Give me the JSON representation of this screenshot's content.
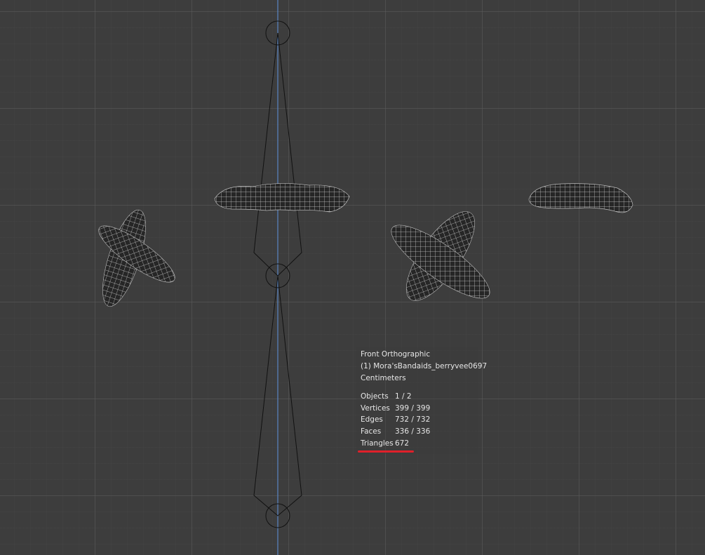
{
  "viewport": {
    "view_name": "Front Orthographic",
    "active_object": "(1) Mora'sBandaids_berryvee0697",
    "units": "Centimeters"
  },
  "stats": [
    {
      "label": "Objects",
      "value": "1 / 2"
    },
    {
      "label": "Vertices",
      "value": "399 / 399"
    },
    {
      "label": "Edges",
      "value": "732 / 732"
    },
    {
      "label": "Faces",
      "value": "336 / 336"
    },
    {
      "label": "Triangles",
      "value": "672"
    }
  ],
  "colors": {
    "background": "#3d3d3d",
    "axis_line": "#5a86c4",
    "armature": "#111111",
    "mesh_fill": "#262626",
    "wireframe": "#cfcfcf",
    "highlight_underline": "#e0202a"
  },
  "icons": {
    "objects": [
      "armature-bone",
      "bandaid-mesh"
    ]
  }
}
